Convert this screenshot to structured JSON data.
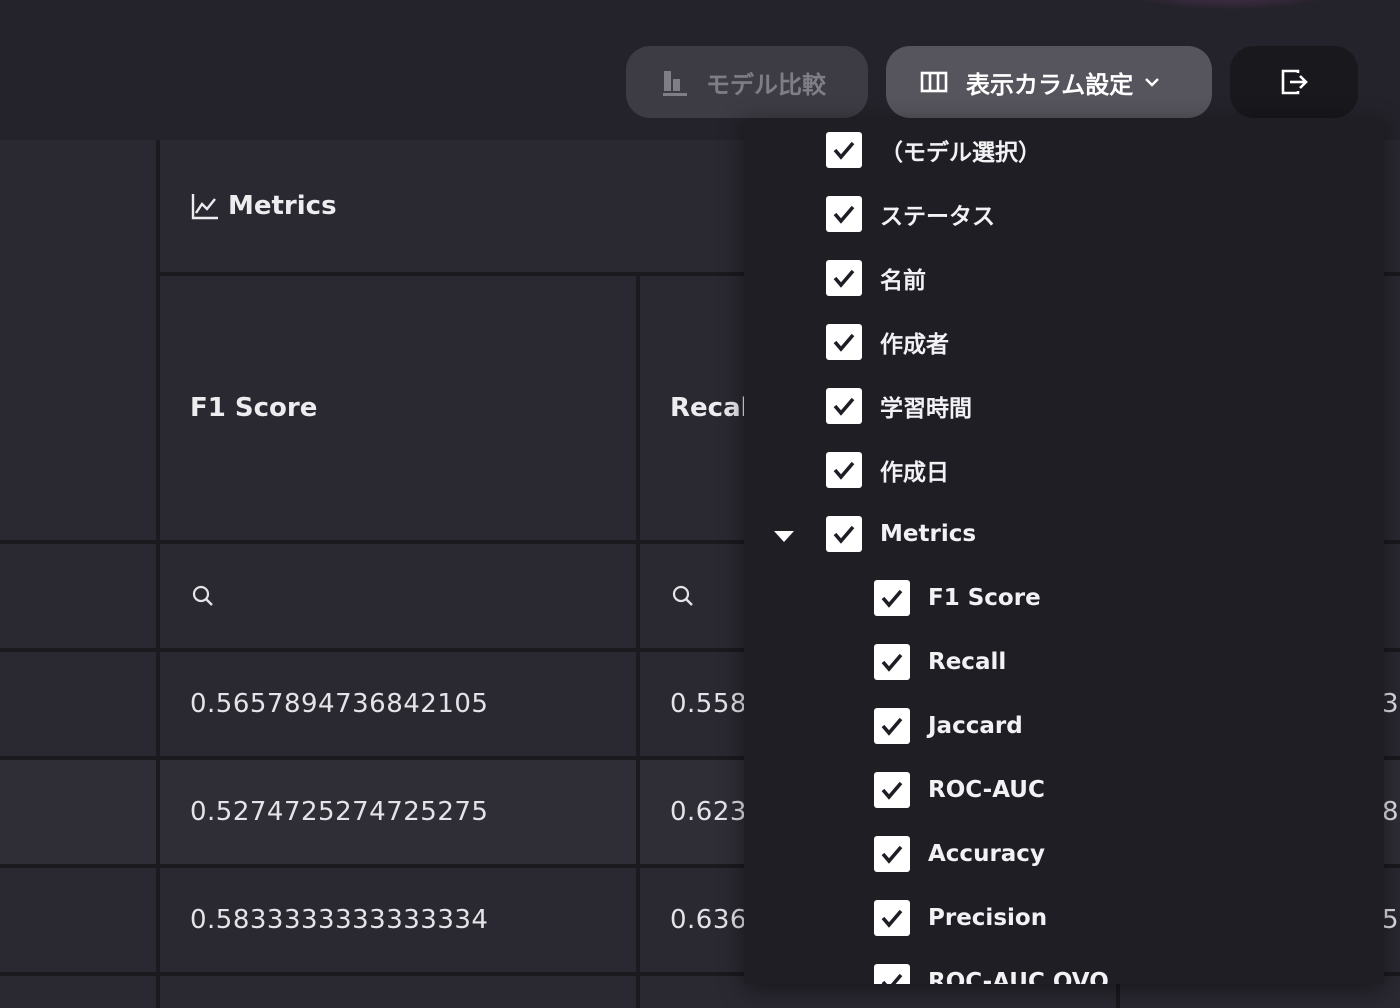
{
  "toolbar": {
    "compare_label": "モデル比較",
    "columns_label": "表示カラム設定"
  },
  "table": {
    "group_header": "Metrics",
    "columns": [
      "F1 Score",
      "Recall"
    ],
    "rows": [
      {
        "f1": "0.5657894736842105",
        "recall": "0.558",
        "right": "3"
      },
      {
        "f1": "0.5274725274725275",
        "recall": "0.623",
        "right": "8"
      },
      {
        "f1": "0.5833333333333334",
        "recall": "0.636",
        "right": "5"
      }
    ]
  },
  "column_menu": {
    "items": [
      {
        "label": "（モデル選択）",
        "checked": true
      },
      {
        "label": "ステータス",
        "checked": true
      },
      {
        "label": "名前",
        "checked": true
      },
      {
        "label": "作成者",
        "checked": true
      },
      {
        "label": "学習時間",
        "checked": true
      },
      {
        "label": "作成日",
        "checked": true
      },
      {
        "label": "Metrics",
        "checked": true,
        "expanded": true
      },
      {
        "label": "F1 Score",
        "checked": true
      },
      {
        "label": "Recall",
        "checked": true
      },
      {
        "label": "Jaccard",
        "checked": true
      },
      {
        "label": "ROC-AUC",
        "checked": true
      },
      {
        "label": "Accuracy",
        "checked": true
      },
      {
        "label": "Precision",
        "checked": true
      },
      {
        "label": "ROC-AUC OVO",
        "checked": true
      }
    ]
  },
  "icons": {
    "compare": "bar-chart-icon",
    "columns": "columns-icon",
    "chevron": "chevron-down-icon",
    "logout": "logout-icon",
    "metrics": "line-chart-icon",
    "search": "search-icon",
    "caret": "caret-down-icon",
    "check": "checkmark-icon"
  }
}
